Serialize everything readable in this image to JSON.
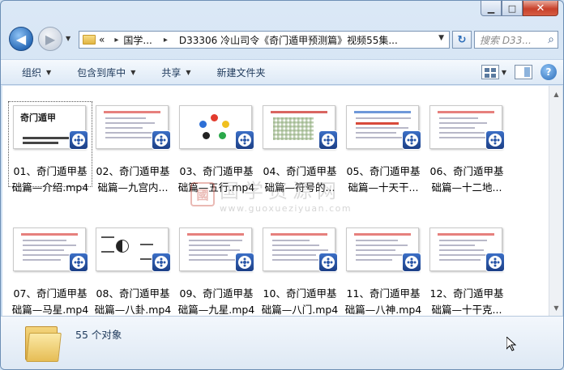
{
  "window": {
    "minimize_glyph": "▁",
    "maximize_glyph": "□",
    "close_glyph": "✕"
  },
  "nav": {
    "back_glyph": "◀",
    "forward_glyph": "▶",
    "history_glyph": "▼"
  },
  "address": {
    "overflow": "«",
    "crumbs": [
      "国学...",
      "D33306 冷山司令《奇门遁甲预测篇》视频55集..."
    ],
    "separator": "▸"
  },
  "refresh_glyph": "↻",
  "search": {
    "placeholder": "搜索 D33...",
    "icon": "search-icon"
  },
  "toolbar": {
    "organize": "组织",
    "include_in_library": "包含到库中",
    "share": "共享",
    "new_folder": "新建文件夹"
  },
  "files": [
    {
      "line1": "01、奇门遁甲基",
      "line2": "础篇—介绍.mp4",
      "selected": true
    },
    {
      "line1": "02、奇门遁甲基",
      "line2": "础篇—九宫内..."
    },
    {
      "line1": "03、奇门遁甲基",
      "line2": "础篇—五行.mp4"
    },
    {
      "line1": "04、奇门遁甲基",
      "line2": "础篇—符号的..."
    },
    {
      "line1": "05、奇门遁甲基",
      "line2": "础篇—十天干..."
    },
    {
      "line1": "06、奇门遁甲基",
      "line2": "础篇—十二地..."
    },
    {
      "line1": "07、奇门遁甲基",
      "line2": "础篇—马星.mp4"
    },
    {
      "line1": "08、奇门遁甲基",
      "line2": "础篇—八卦.mp4"
    },
    {
      "line1": "09、奇门遁甲基",
      "line2": "础篇—九星.mp4"
    },
    {
      "line1": "10、奇门遁甲基",
      "line2": "础篇—八门.mp4"
    },
    {
      "line1": "11、奇门遁甲基",
      "line2": "础篇—八神.mp4"
    },
    {
      "line1": "12、奇门遁甲基",
      "line2": "础篇—十干克..."
    }
  ],
  "thumb1_title": "奇门遁甲",
  "watermark": {
    "seal": "國",
    "big": "国学资源网",
    "small": "www.guoxueziyuan.com"
  },
  "status": {
    "count": "55 个对象"
  },
  "colors": {
    "accent": "#2b6cb8",
    "close": "#c8412b"
  }
}
